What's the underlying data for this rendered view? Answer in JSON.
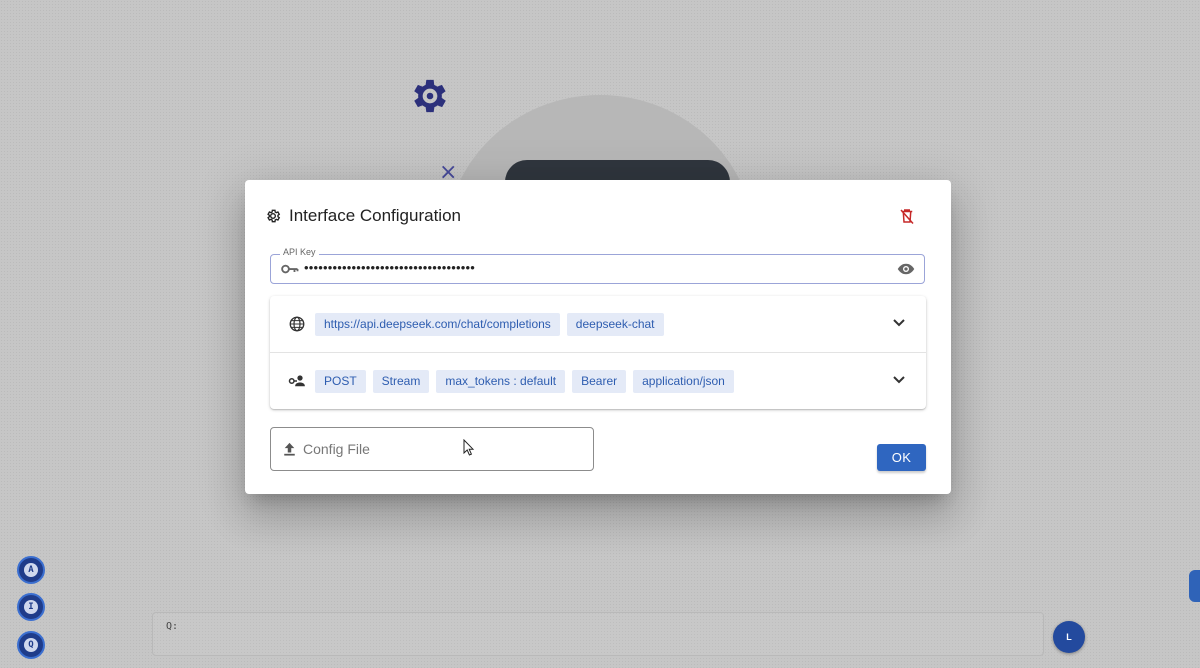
{
  "dialog": {
    "title": "Interface Configuration",
    "api_key": {
      "label": "API Key",
      "value": "••••••••••••••••••••••••••••••••••••"
    },
    "endpoint": {
      "chips": [
        "https://api.deepseek.com/chat/completions",
        "deepseek-chat"
      ]
    },
    "request": {
      "chips": [
        "POST",
        "Stream",
        "max_tokens : default",
        "Bearer",
        "application/json"
      ]
    },
    "config_file_label": "Config File",
    "ok_label": "OK"
  },
  "side_buttons": [
    "A",
    "I",
    "Q"
  ],
  "query_bar": {
    "placeholder": "Q:"
  },
  "l_button": "L",
  "colors": {
    "accent": "#2f66c0",
    "chip_bg": "#e4eaf7",
    "chip_text": "#2e5db0",
    "delete": "#c62828",
    "gear_bg": "#1a1f7a"
  },
  "icons": {
    "title": "gear-icon",
    "delete": "delete-config-icon",
    "api_key": "key-icon",
    "visibility": "eye-icon",
    "endpoint": "globe-icon",
    "request": "user-key-icon",
    "expand": "chevron-down-icon",
    "upload": "upload-icon"
  }
}
